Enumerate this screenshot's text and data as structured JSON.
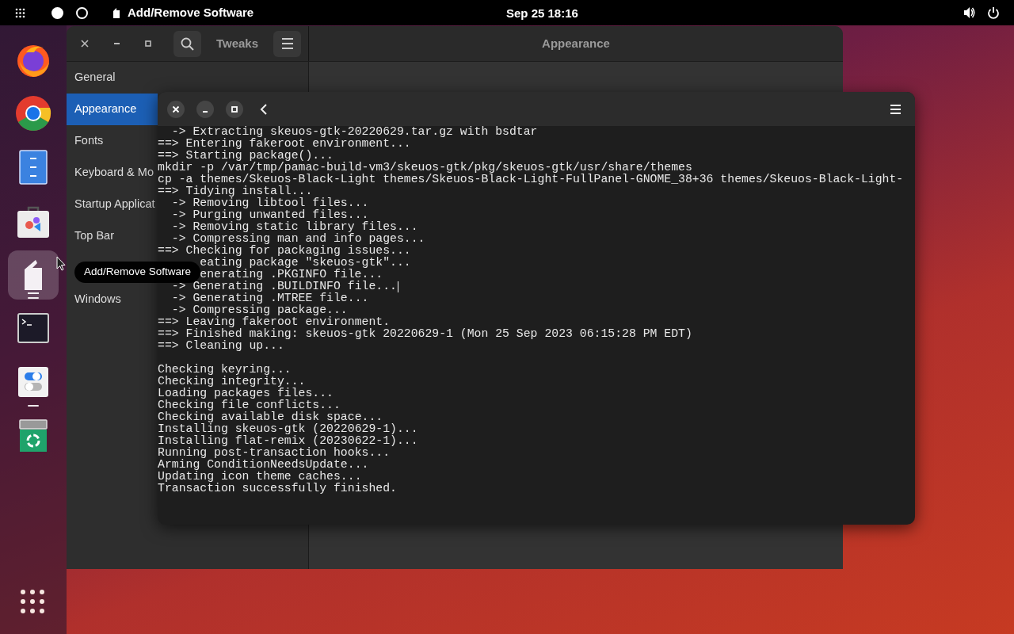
{
  "top_bar": {
    "app_name": "Add/Remove Software",
    "clock": "Sep 25 18:16",
    "workspaces": [
      {
        "selected": true
      },
      {
        "selected": false
      }
    ]
  },
  "dock": {
    "items": [
      {
        "kind": "firefox",
        "running": false,
        "hovered": false
      },
      {
        "kind": "chrome",
        "running": false,
        "hovered": false
      },
      {
        "kind": "files",
        "running": false,
        "hovered": false
      },
      {
        "kind": "store",
        "running": false,
        "hovered": false
      },
      {
        "kind": "package",
        "running": true,
        "hovered": true
      },
      {
        "kind": "terminal",
        "running": false,
        "hovered": false
      },
      {
        "kind": "tweaks",
        "running": true,
        "hovered": false
      },
      {
        "kind": "trash",
        "running": false,
        "hovered": false
      }
    ]
  },
  "tooltip": "Add/Remove Software",
  "tweaks_window": {
    "title": "Tweaks",
    "page_title": "Appearance",
    "sidebar": [
      {
        "kind": "item",
        "label": "General",
        "selected": false
      },
      {
        "kind": "item",
        "label": "Appearance",
        "selected": true
      },
      {
        "kind": "item",
        "label": "Fonts",
        "selected": false
      },
      {
        "kind": "item",
        "label": "Keyboard & Mo",
        "selected": false
      },
      {
        "kind": "item",
        "label": "Startup Applicat",
        "selected": false
      },
      {
        "kind": "item",
        "label": "Top Bar",
        "selected": false
      },
      {
        "kind": "covered",
        "selected": false
      },
      {
        "kind": "item",
        "label": "Windows",
        "selected": false
      }
    ]
  },
  "terminal_window": {
    "build_log": [
      {
        "text": "  -> Extracting skeuos-gtk-20220629.tar.gz with bsdtar",
        "caret": false
      },
      {
        "text": "==> Entering fakeroot environment...",
        "caret": false
      },
      {
        "text": "==> Starting package()...",
        "caret": false
      },
      {
        "text": "mkdir -p /var/tmp/pamac-build-vm3/skeuos-gtk/pkg/skeuos-gtk/usr/share/themes",
        "caret": false
      },
      {
        "text": "cp -a themes/Skeuos-Black-Light themes/Skeuos-Black-Light-FullPanel-GNOME_38+36 themes/Skeuos-Black-Light-",
        "caret": false
      },
      {
        "text": "==> Tidying install...",
        "caret": false
      },
      {
        "text": "  -> Removing libtool files...",
        "caret": false
      },
      {
        "text": "  -> Purging unwanted files...",
        "caret": false
      },
      {
        "text": "  -> Removing static library files...",
        "caret": false
      },
      {
        "text": "  -> Compressing man and info pages...",
        "caret": false
      },
      {
        "text": "==> Checking for packaging issues...",
        "caret": false
      },
      {
        "kind": "covered",
        "text": "eating package \"skeuos-gtk\"...",
        "caret": false
      },
      {
        "kind": "covered",
        "text": "enerating .PKGINFO file...",
        "caret": false
      },
      {
        "text": "  -> Generating .BUILDINFO file...",
        "caret": true
      },
      {
        "text": "  -> Generating .MTREE file...",
        "caret": false
      },
      {
        "text": "  -> Compressing package...",
        "caret": false
      },
      {
        "text": "==> Leaving fakeroot environment.",
        "caret": false
      },
      {
        "text": "==> Finished making: skeuos-gtk 20220629-1 (Mon 25 Sep 2023 06:15:28 PM EDT)",
        "caret": false
      },
      {
        "text": "==> Cleaning up...",
        "caret": false
      }
    ],
    "transaction_log": [
      {
        "text": "Checking keyring...",
        "caret": false
      },
      {
        "text": "Checking integrity...",
        "caret": false
      },
      {
        "text": "Loading packages files...",
        "caret": false
      },
      {
        "text": "Checking file conflicts...",
        "caret": false
      },
      {
        "text": "Checking available disk space...",
        "caret": false
      },
      {
        "text": "Installing skeuos-gtk (20220629-1)...",
        "caret": false
      },
      {
        "text": "Installing flat-remix (20230622-1)...",
        "caret": false
      },
      {
        "text": "Running post-transaction hooks...",
        "caret": false
      },
      {
        "text": "Arming ConditionNeedsUpdate...",
        "caret": false
      },
      {
        "text": "Updating icon theme caches...",
        "caret": false
      },
      {
        "text": "Transaction successfully finished.",
        "caret": false
      }
    ]
  }
}
